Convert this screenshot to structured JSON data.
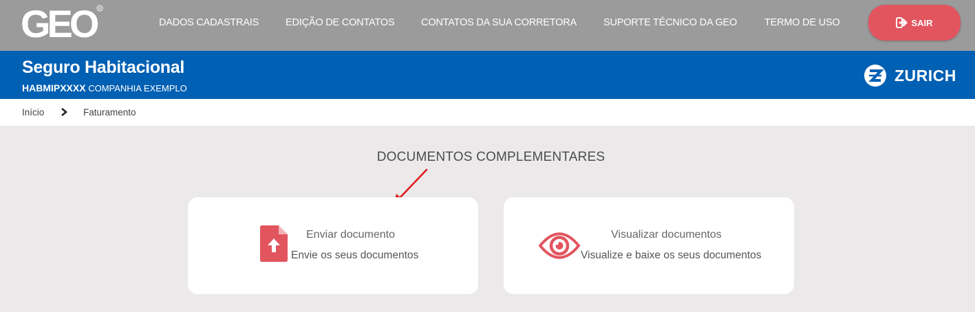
{
  "header": {
    "logo_text": "GEO",
    "nav": [
      "DADOS CADASTRAIS",
      "EDIÇÃO DE CONTATOS",
      "CONTATOS DA SUA CORRETORA",
      "SUPORTE TÉCNICO DA GEO",
      "TERMO DE USO"
    ],
    "logout_label": "SAIR"
  },
  "product": {
    "title": "Seguro Habitacional",
    "code": "HABMIPXXXX",
    "company": " COMPANHIA EXEMPLO",
    "insurer_name": "ZURICH"
  },
  "breadcrumb": {
    "items": [
      "Início",
      "Faturamento"
    ]
  },
  "main": {
    "section_title": "DOCUMENTOS COMPLEMENTARES",
    "cards": [
      {
        "title": "Enviar documento",
        "description": "Envie os seus documentos",
        "icon": "file-upload-icon"
      },
      {
        "title": "Visualizar documentos",
        "description": "Visualize e baixe os seus documentos",
        "icon": "eye-icon"
      }
    ]
  },
  "colors": {
    "topbar": "#9b9b9b",
    "brand_blue": "#0060b3",
    "accent_red": "#e2555f",
    "background": "#ebe9ea"
  }
}
